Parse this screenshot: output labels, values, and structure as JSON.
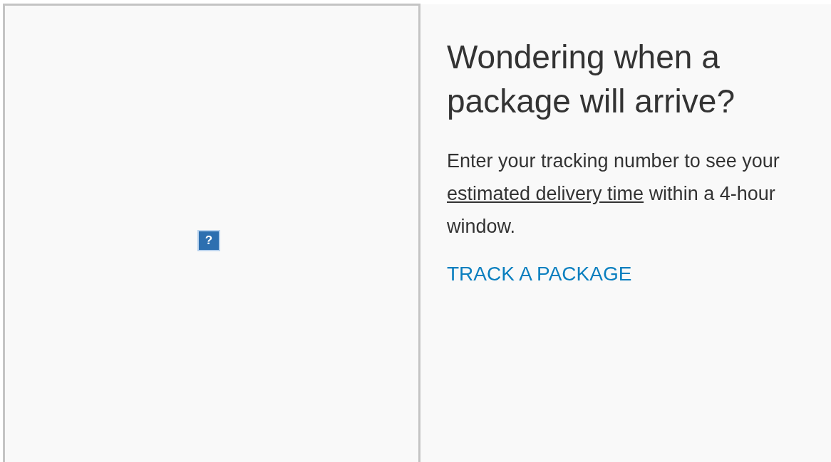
{
  "media": {
    "kind": "broken-image",
    "glyph": "?"
  },
  "promo": {
    "heading": "Wondering when a package will arrive?",
    "body": {
      "before": "Enter your tracking number to see your",
      "link": "estimated delivery time",
      "after": "within a 4-hour window."
    },
    "cta": "TRACK A PACKAGE"
  }
}
